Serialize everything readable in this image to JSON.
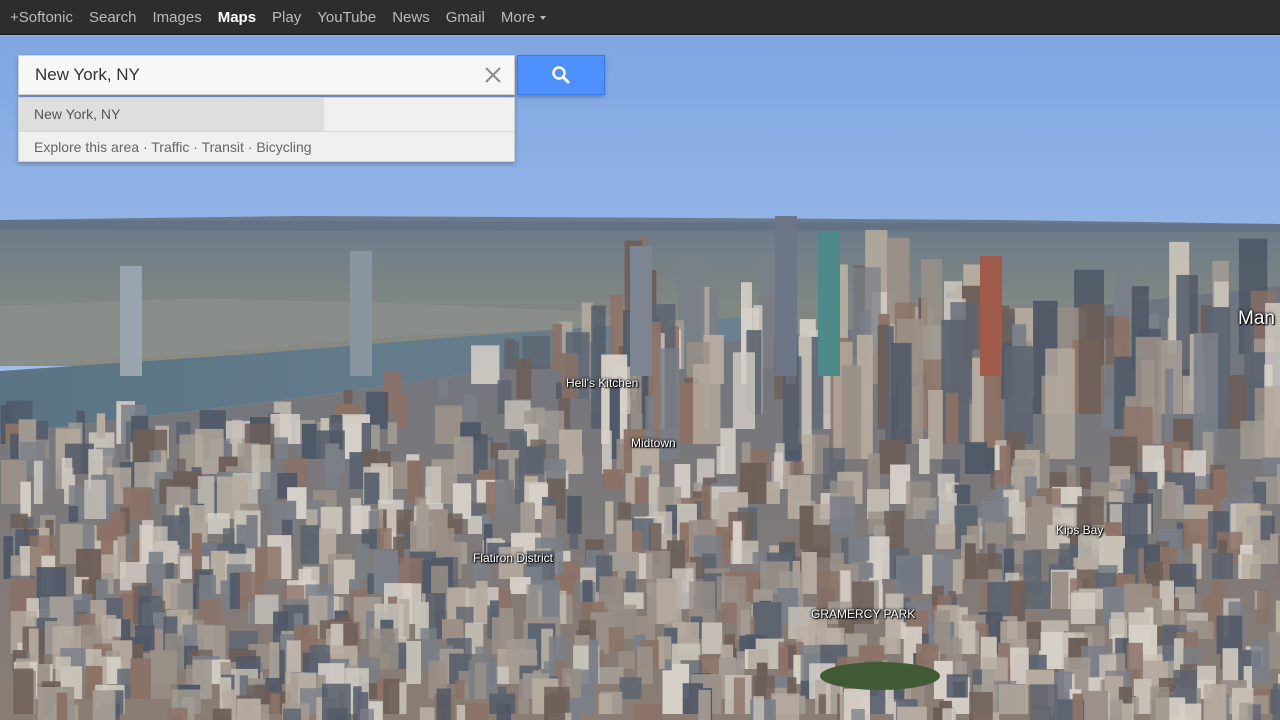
{
  "topbar": {
    "items": [
      {
        "label": "+Softonic"
      },
      {
        "label": "Search"
      },
      {
        "label": "Images"
      },
      {
        "label": "Maps",
        "active": true
      },
      {
        "label": "Play"
      },
      {
        "label": "YouTube"
      },
      {
        "label": "News"
      },
      {
        "label": "Gmail"
      },
      {
        "label": "More"
      }
    ]
  },
  "search": {
    "value": "New York, NY",
    "suggestion": "New York, NY",
    "explore": {
      "area": "Explore this area",
      "traffic": "Traffic",
      "transit": "Transit",
      "bicycling": "Bicycling",
      "separator": " · "
    }
  },
  "map": {
    "labels": {
      "hells_kitchen": "Hell's Kitchen",
      "midtown": "Midtown",
      "kips_bay": "Kips Bay",
      "flatiron": "Flatiron District",
      "gramercy": "GRAMERCY PARK",
      "manhattan": "Man"
    }
  },
  "colors": {
    "accent": "#4d90fe",
    "topbar": "#2d2d2d",
    "sky_top": "#7fa6e2",
    "sky_bottom": "#bcd2ee",
    "river": "#5f7786"
  }
}
